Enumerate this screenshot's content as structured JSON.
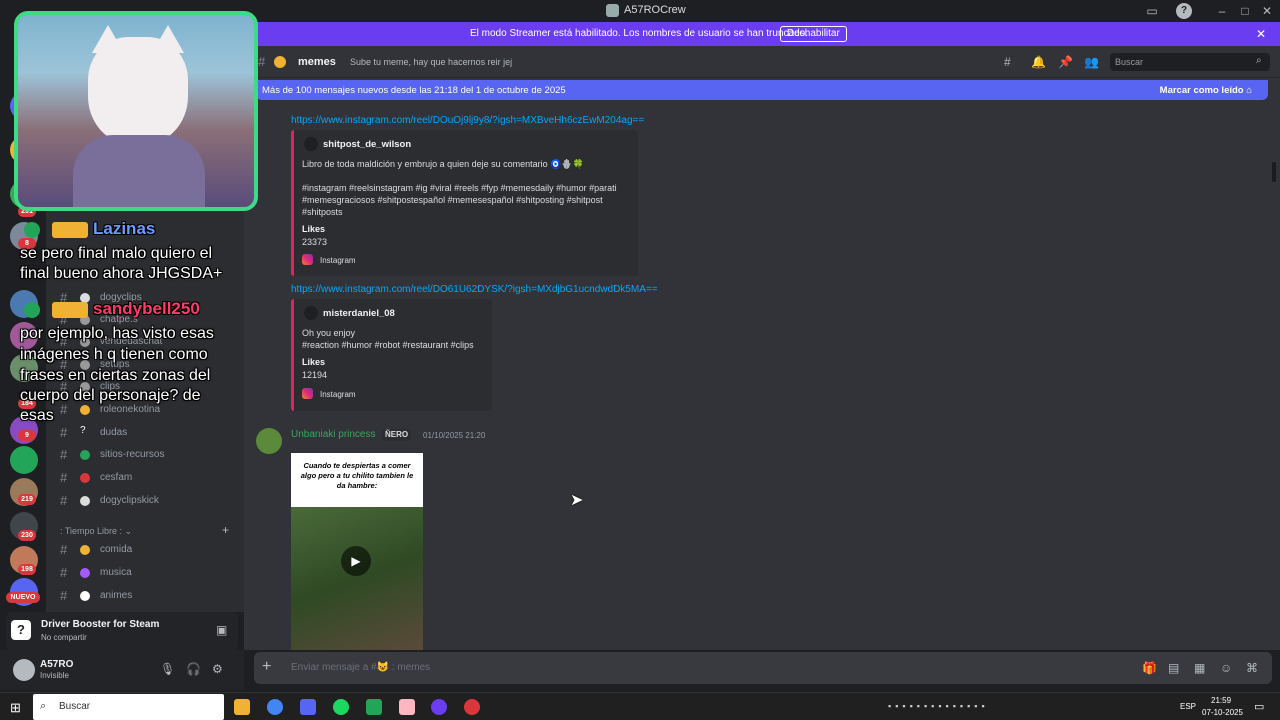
{
  "window": {
    "title": "A57ROCrew"
  },
  "streamer_banner": {
    "message": "El modo Streamer está habilitado. Los nombres de usuario se han truncado.",
    "button": "Deshabilitar"
  },
  "channel_header": {
    "name": "memes",
    "topic": "Sube tu meme, hay que hacernos reir jej",
    "search_placeholder": "Buscar"
  },
  "new_messages_bar": {
    "text": "Más de 100 mensajes nuevos desde las 21:18 del 1 de octubre de 2025",
    "mark_read": "Marcar como leído"
  },
  "server_badges": [
    "291",
    "8",
    "184",
    "9",
    "219",
    "230",
    "198"
  ],
  "server_new_badge": "NUEVO",
  "channels": [
    {
      "name": "dogyclips",
      "color": "#dcdcdc"
    },
    {
      "name": "chatpe.s",
      "color": "#999999"
    },
    {
      "name": "vendedaschat",
      "color": "#999999"
    },
    {
      "name": "setups",
      "color": "#999999"
    },
    {
      "name": "clips",
      "color": "#999999"
    },
    {
      "name": "roleonekotina",
      "color": "#f0b232"
    },
    {
      "name": "dudas",
      "color": "#ffffff"
    },
    {
      "name": "sitios-recursos",
      "color": "#23a559"
    },
    {
      "name": "cesfam",
      "color": "#da373c"
    },
    {
      "name": "dogyclipskick",
      "color": "#dcdcdc"
    }
  ],
  "category": {
    "label": ": Tiempo Libre :"
  },
  "channels2": [
    {
      "name": "comida",
      "color": "#f0b232"
    },
    {
      "name": "musica",
      "color": "#a55aff"
    },
    {
      "name": "animes",
      "color": "#ffffff"
    }
  ],
  "activity": {
    "title": "Driver Booster for Steam",
    "subtitle": "No compartir"
  },
  "user": {
    "name": "A57RO",
    "status": "Invisible"
  },
  "messages": {
    "link1": "https://www.instagram.com/reel/DOuOj9lj9y8/?igsh=MXBveHh6czEwM204ag==",
    "embed1": {
      "author": "shitpost_de_wilson",
      "desc1": "Libro de toda maldición y embrujo a quien deje su comentario 🧿🪬🍀",
      "desc2": "#instagram #reelsinstagram #ig #viral #reels #fyp #memesdaily #humor #parati",
      "desc3": "#memesgraciosos #shitpostespañol #memesespañol #shitposting #shitpost",
      "desc4": "#shitposts",
      "field_name": "Likes",
      "field_value": "23373",
      "footer": "Instagram"
    },
    "link2": "https://www.instagram.com/reel/DO61U62DYSK/?igsh=MXdjbG1ucndwdDk5MA==",
    "embed2": {
      "author": "misterdaniel_08",
      "desc1": "Oh you enjoy",
      "desc2": "#reaction #humor #robot #restaurant #clips",
      "field_name": "Likes",
      "field_value": "12194",
      "footer": "Instagram"
    },
    "post": {
      "author": "Unbaniaki princess",
      "tag": "ÑERO",
      "timestamp": "01/10/2025 21:20",
      "image_caption": "Cuando te despiertas a comer algo pero a tu chilito tambien le da hambre:"
    }
  },
  "composer": {
    "placeholder": "Enviar mensaje a #😺 : memes"
  },
  "overlay_chat": [
    {
      "user": "Lazinas",
      "user_color": "#6b9cff",
      "text1": "se pero final malo quiero el",
      "text2": "final bueno ahora JHGSDA+"
    },
    {
      "user": "sandybell250",
      "user_color": "#ff3b6b",
      "text1": "por ejemplo, has visto esas",
      "text2": "imágenes h q tienen como",
      "text3": "frases en ciertas zonas del",
      "text4": "cuerpo del personaje? de",
      "text5": "esas"
    }
  ],
  "taskbar": {
    "search": "Buscar",
    "lang": "ESP",
    "time": "21:59",
    "date": "07-10-2025"
  }
}
